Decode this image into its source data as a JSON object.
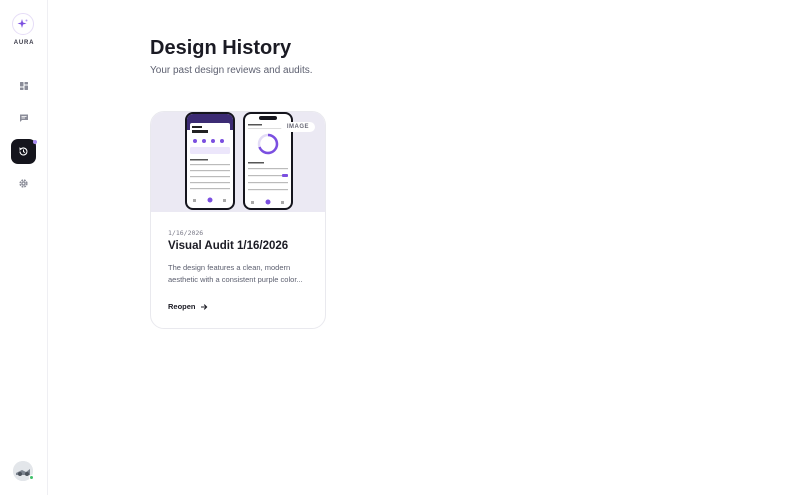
{
  "sidebar": {
    "brand": "AURA",
    "items": [
      {
        "name": "dashboard",
        "icon": "dashboard-icon",
        "active": false
      },
      {
        "name": "reviews",
        "icon": "chat-icon",
        "active": false
      },
      {
        "name": "history",
        "icon": "history-icon",
        "active": true
      },
      {
        "name": "settings",
        "icon": "gear-icon",
        "active": false
      }
    ]
  },
  "page": {
    "title": "Design History",
    "subtitle": "Your past design reviews and audits."
  },
  "cards": [
    {
      "badge": "IMAGE",
      "date": "1/16/2026",
      "title": "Visual Audit 1/16/2026",
      "description": "The design features a clean, modern aesthetic with a consistent purple color...",
      "action_label": "Reopen"
    }
  ],
  "colors": {
    "accent": "#7b4fe0",
    "active_nav": "#15151d",
    "thumbnail_bg": "#ebe9f3"
  }
}
